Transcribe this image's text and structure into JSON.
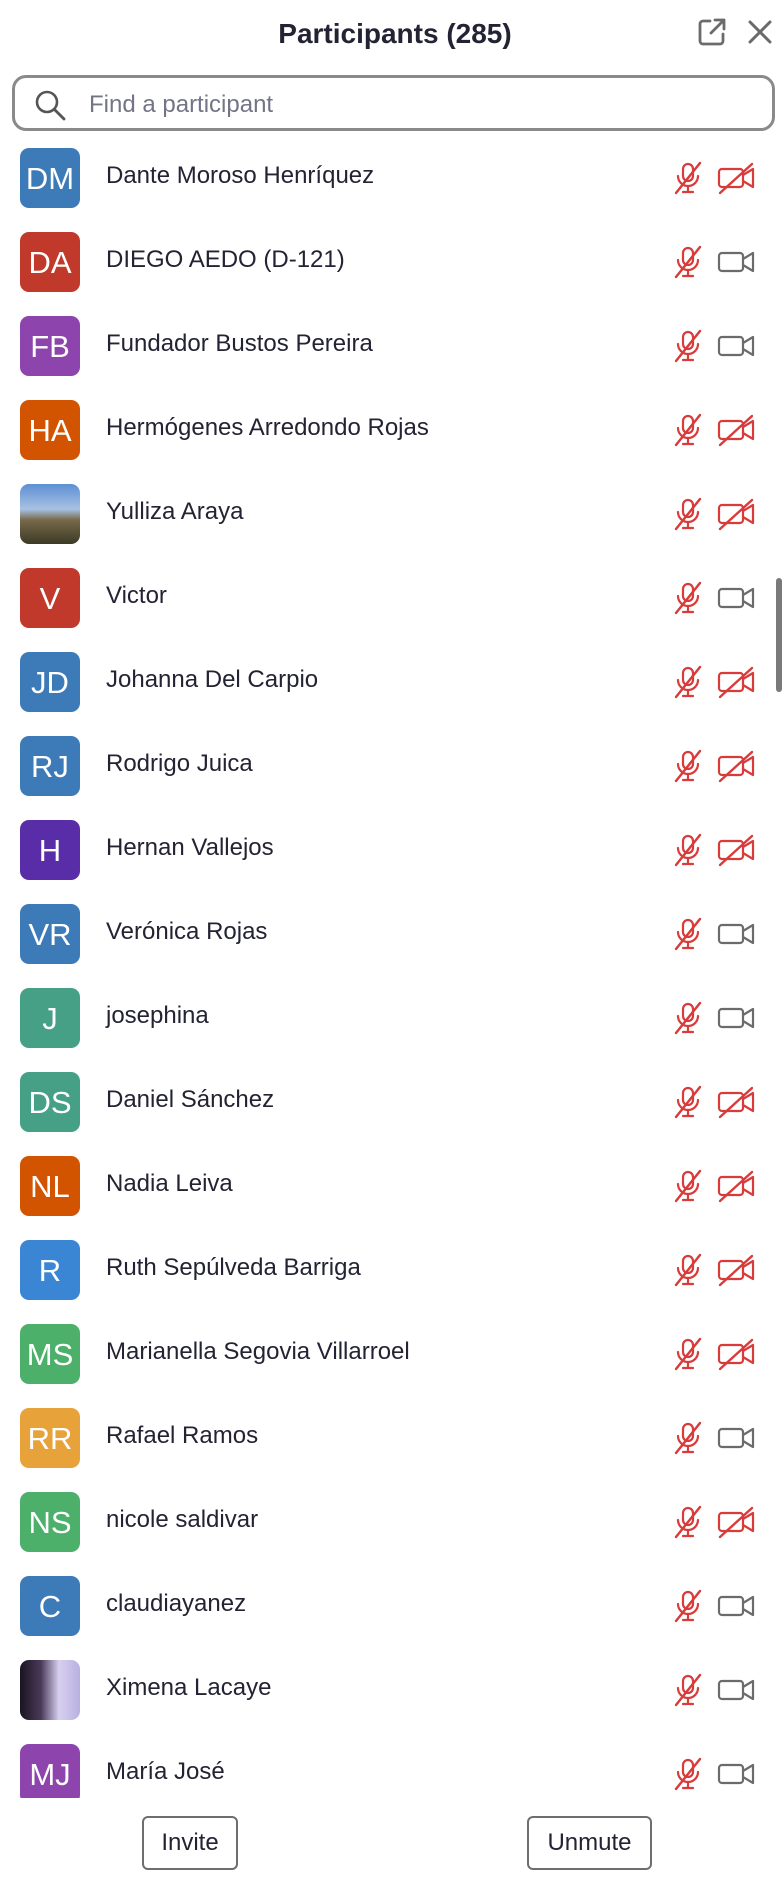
{
  "header": {
    "title": "Participants (285)"
  },
  "search": {
    "placeholder": "Find a participant"
  },
  "colors": {
    "muted_red": "#d93a3a",
    "camera_gray": "#6b6b6b"
  },
  "participants": [
    {
      "initials": "DM",
      "name": "Dante Moroso Henríquez",
      "color": "#3d7ab8",
      "mic": "muted",
      "video": "off"
    },
    {
      "initials": "DA",
      "name": "DIEGO AEDO (D-121)",
      "color": "#c0392b",
      "mic": "muted",
      "video": "on"
    },
    {
      "initials": "FB",
      "name": "Fundador Bustos Pereira",
      "color": "#8e44ad",
      "mic": "muted",
      "video": "on"
    },
    {
      "initials": "HA",
      "name": "Hermógenes Arredondo Rojas",
      "color": "#d35400",
      "mic": "muted",
      "video": "off"
    },
    {
      "initials": "",
      "name": "Yulliza Araya",
      "color": "",
      "photo": "photo1",
      "mic": "muted",
      "video": "off"
    },
    {
      "initials": "V",
      "name": "Victor",
      "color": "#c0392b",
      "mic": "muted",
      "video": "on"
    },
    {
      "initials": "JD",
      "name": "Johanna Del Carpio",
      "color": "#3d7ab8",
      "mic": "muted",
      "video": "off"
    },
    {
      "initials": "RJ",
      "name": "Rodrigo Juica",
      "color": "#3d7ab8",
      "mic": "muted",
      "video": "off"
    },
    {
      "initials": "H",
      "name": "Hernan Vallejos",
      "color": "#5a2da8",
      "mic": "muted",
      "video": "off"
    },
    {
      "initials": "VR",
      "name": "Verónica Rojas",
      "color": "#3d7ab8",
      "mic": "muted",
      "video": "on"
    },
    {
      "initials": "J",
      "name": "josephina",
      "color": "#45a085",
      "mic": "muted",
      "video": "on"
    },
    {
      "initials": "DS",
      "name": "Daniel Sánchez",
      "color": "#45a085",
      "mic": "muted",
      "video": "off"
    },
    {
      "initials": "NL",
      "name": "Nadia Leiva",
      "color": "#d35400",
      "mic": "muted",
      "video": "off"
    },
    {
      "initials": "R",
      "name": "Ruth Sepúlveda Barriga",
      "color": "#3a86d4",
      "mic": "muted",
      "video": "off"
    },
    {
      "initials": "MS",
      "name": "Marianella Segovia Villarroel",
      "color": "#4caf6a",
      "mic": "muted",
      "video": "off"
    },
    {
      "initials": "RR",
      "name": "Rafael Ramos",
      "color": "#e8a23a",
      "mic": "muted",
      "video": "on"
    },
    {
      "initials": "NS",
      "name": "nicole saldivar",
      "color": "#4caf6a",
      "mic": "muted",
      "video": "off"
    },
    {
      "initials": "C",
      "name": "claudiayanez",
      "color": "#3d7ab8",
      "mic": "muted",
      "video": "on"
    },
    {
      "initials": "",
      "name": "Ximena Lacaye",
      "color": "",
      "photo": "photo2",
      "mic": "muted",
      "video": "on"
    },
    {
      "initials": "MJ",
      "name": "María José",
      "color": "#8e44ad",
      "mic": "muted",
      "video": "on"
    }
  ],
  "footer": {
    "invite_label": "Invite",
    "unmute_label": "Unmute"
  }
}
